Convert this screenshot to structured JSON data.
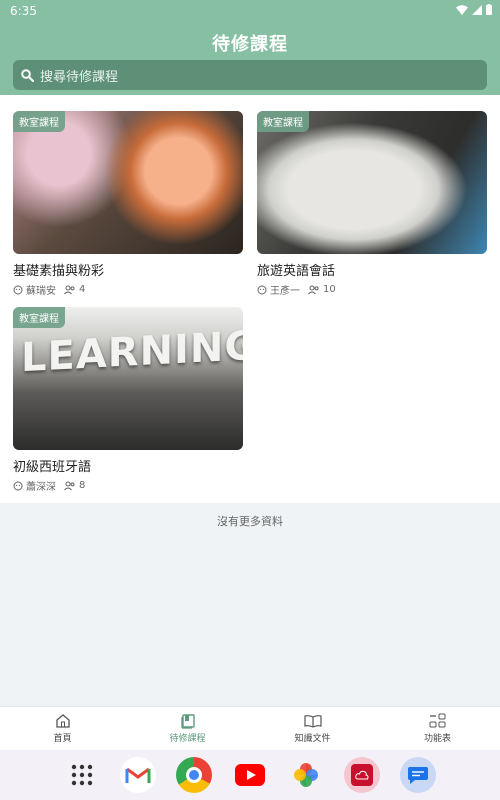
{
  "status_bar": {
    "time": "6:35"
  },
  "header": {
    "title": "待修課程"
  },
  "search": {
    "placeholder": "搜尋待修課程"
  },
  "courses": [
    {
      "badge": "教室課程",
      "title": "基礎素描與粉彩",
      "teacher": "蘇瑞安",
      "students": "4"
    },
    {
      "badge": "教室課程",
      "title": "旅遊英語會話",
      "teacher": "王彥一",
      "students": "10"
    },
    {
      "badge": "教室課程",
      "title": "初級西班牙語",
      "teacher": "蕭深深",
      "students": "8",
      "image_text": "LEARNING"
    }
  ],
  "footer_note": "沒有更多資料",
  "tabs": [
    {
      "label": "首頁",
      "icon": "home-icon",
      "active": false
    },
    {
      "label": "待修課程",
      "icon": "course-book-icon",
      "active": true
    },
    {
      "label": "知識文件",
      "icon": "open-book-icon",
      "active": false
    },
    {
      "label": "功能表",
      "icon": "menu-grid-icon",
      "active": false
    }
  ],
  "dock_apps": [
    "app-drawer-icon",
    "gmail-icon",
    "chrome-icon",
    "youtube-icon",
    "photos-icon",
    "cloud-app-icon",
    "messages-icon"
  ],
  "colors": {
    "header": "#86bfa2",
    "search": "#5e9078",
    "accent": "#5e9a7e"
  }
}
